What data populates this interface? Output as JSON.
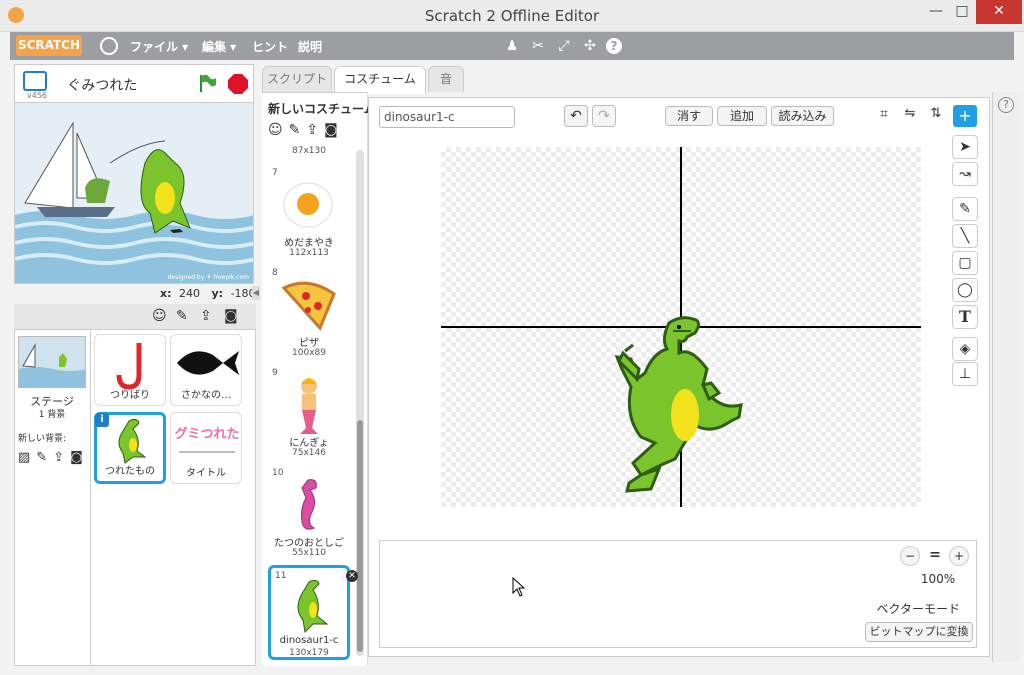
{
  "window": {
    "title": "Scratch 2 Offline Editor",
    "controls": {
      "minimize": "—",
      "maximize": "□",
      "close": "✕"
    }
  },
  "menubar": {
    "logo": "SCRATCH",
    "file": "ファイル ▾",
    "edit": "編集 ▾",
    "hint": "ヒント",
    "explain": "説明"
  },
  "stage": {
    "version": "v456",
    "project_name": "ぐみつれた",
    "credit": "designed by ⚘ freepik.com",
    "x_label": "x:",
    "x_value": "240",
    "y_label": "y:",
    "y_value": "-180"
  },
  "sprite_panel": {
    "stage_label": "ステージ",
    "stage_sub": "1 背景",
    "new_backdrop": "新しい背景:",
    "sprites": [
      {
        "name": "つりばり"
      },
      {
        "name": "さかなの…"
      },
      {
        "name": "つれたもの"
      },
      {
        "name": "タイトル"
      }
    ],
    "title_sprite_text": "グミつれた"
  },
  "tabs": {
    "script": "スクリプト",
    "costume": "コスチューム",
    "sound": "音"
  },
  "costume_panel": {
    "new_costume": "新しいコスチューム:",
    "top_size": "87x130",
    "costumes": [
      {
        "num": "7",
        "name": "めだまやき",
        "size": "112x113"
      },
      {
        "num": "8",
        "name": "ピザ",
        "size": "100x89"
      },
      {
        "num": "9",
        "name": "にんぎょ",
        "size": "75x146"
      },
      {
        "num": "10",
        "name": "たつのおとしご",
        "size": "55x110"
      },
      {
        "num": "11",
        "name": "dinosaur1-c",
        "size": "130x179"
      }
    ]
  },
  "editor": {
    "costume_name": "dinosaur1-c",
    "clear": "消す",
    "add": "追加",
    "import": "読み込み",
    "zoom": "100%",
    "mode": "ベクターモード",
    "convert": "ビットマップに変換"
  },
  "colors": {
    "accent": "#1fa0e0",
    "menubar": "#9c9ea1",
    "dino": "#7cc42c",
    "stop": "#e0112b",
    "flag": "#2e8b3a"
  }
}
